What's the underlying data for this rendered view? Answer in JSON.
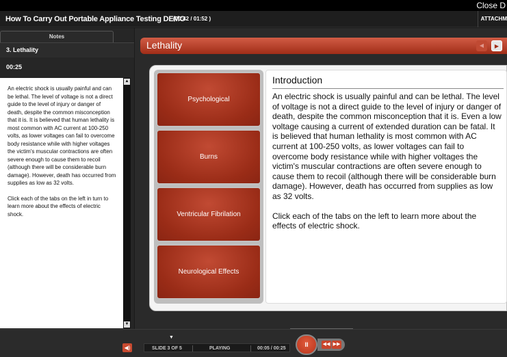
{
  "window": {
    "close_label": "Close D"
  },
  "course": {
    "title": "How To Carry Out Portable Appliance Testing DEMO",
    "timer": "(00:42 / 01:52 )",
    "attachments_label": "ATTACHM"
  },
  "notes": {
    "tab_label": "Notes",
    "slide_title": "3. Lethality",
    "slide_time": "00:25",
    "paragraphs": [
      "An electric shock is usually painful and can be lethal. The level of voltage is not a direct guide to the level of injury or danger of death, despite the common misconception that it is. It is believed that human lethality is most common with AC current at 100-250 volts, as lower voltages can fail to overcome body resistance while with higher voltages the victim's muscular contractions are often severe enough to cause them to recoil (although there will be considerable burn damage). However, death has occurred from supplies as low as 32 volts.",
      "Click each of the tabs on the left in turn to learn more about the effects of electric shock."
    ]
  },
  "slide": {
    "title": "Lethality",
    "tabs": [
      "Psychological",
      "Burns",
      "Ventricular Fibrilation",
      "Neurological Effects"
    ],
    "content_heading": "Introduction",
    "content_paragraphs": [
      "An electric shock is usually painful and can be lethal. The level of voltage is not a direct guide to the level of injury or danger of death, despite the common misconception that it is. Even a low voltage causing a current of extended duration can be fatal. It is believed that human lethality is most common with AC current at 100-250 volts, as lower voltages can fail to overcome body resistance while with higher voltages the victim's muscular contractions are often severe enough to cause them to recoil (although there will be considerable burn damage). However, death has occurred from supplies as low as 32 volts.",
      "Click each of the tabs on the left to learn more about the effects of electric shock."
    ]
  },
  "player": {
    "slide_count": "SLIDE 3 OF 5",
    "state": "PLAYING",
    "time": "00:05 / 00:25"
  },
  "icons": {
    "prev": "previous-slide-icon",
    "next": "next-slide-icon",
    "volume": "volume-icon",
    "pause": "pause-icon",
    "skip_back": "skip-back-icon",
    "skip_forward": "skip-forward-icon"
  },
  "colors": {
    "accent": "#b8341b",
    "tab_red": "#9a2c17",
    "background": "#1b1b1b"
  }
}
